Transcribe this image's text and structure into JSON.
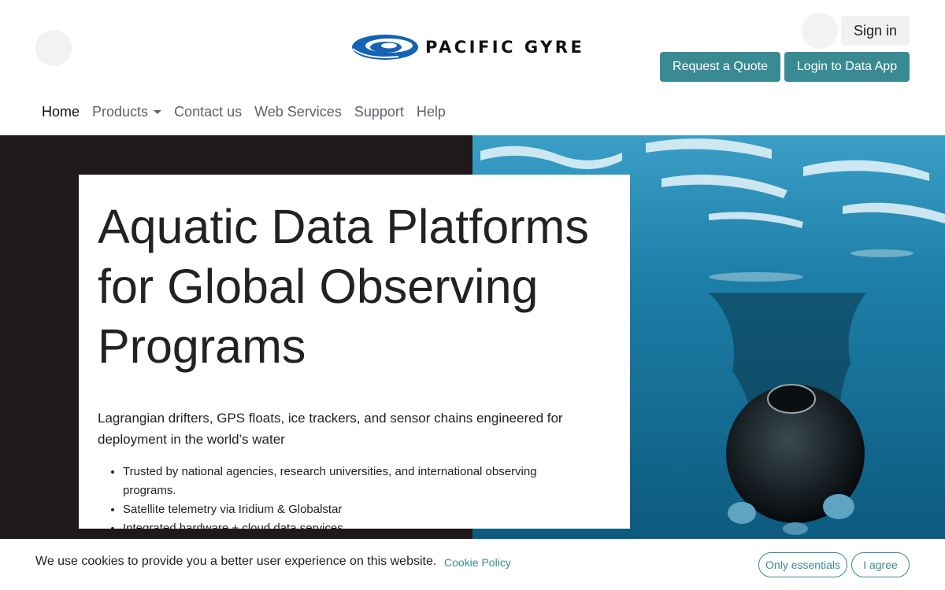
{
  "header": {
    "brand": "PACIFIC GYRE",
    "sign_in": "Sign in",
    "request_quote": "Request a Quote",
    "login_data_app": "Login to Data App"
  },
  "nav": {
    "items": [
      {
        "label": "Home",
        "active": true
      },
      {
        "label": "Products",
        "dropdown": true
      },
      {
        "label": "Contact us"
      },
      {
        "label": "Web Services"
      },
      {
        "label": "Support"
      },
      {
        "label": "Help"
      }
    ]
  },
  "hero": {
    "title": "Aquatic Data Platforms for Global Observing Programs",
    "subtitle": "Lagrangian drifters, GPS floats, ice trackers, and sensor chains engineered for deployment in the world’s water",
    "bullets": [
      "Trusted by national agencies, research universities, and international observing programs.",
      "Satellite telemetry via Iridium & Globalstar",
      "Integrated hardware + cloud data services"
    ]
  },
  "cookie": {
    "message": "We use cookies to provide you a better user experience on this website.",
    "policy_link": "Cookie Policy",
    "only_essentials": "Only essentials",
    "agree": "I agree"
  },
  "colors": {
    "accent": "#3a8a94",
    "hero_dark": "#1f191a",
    "logo_blue": "#1463b4"
  },
  "icons": {
    "menu": "menu-icon",
    "user": "user-avatar-icon",
    "logo": "pacific-gyre-swirl-icon",
    "dropdown": "chevron-down-icon"
  }
}
